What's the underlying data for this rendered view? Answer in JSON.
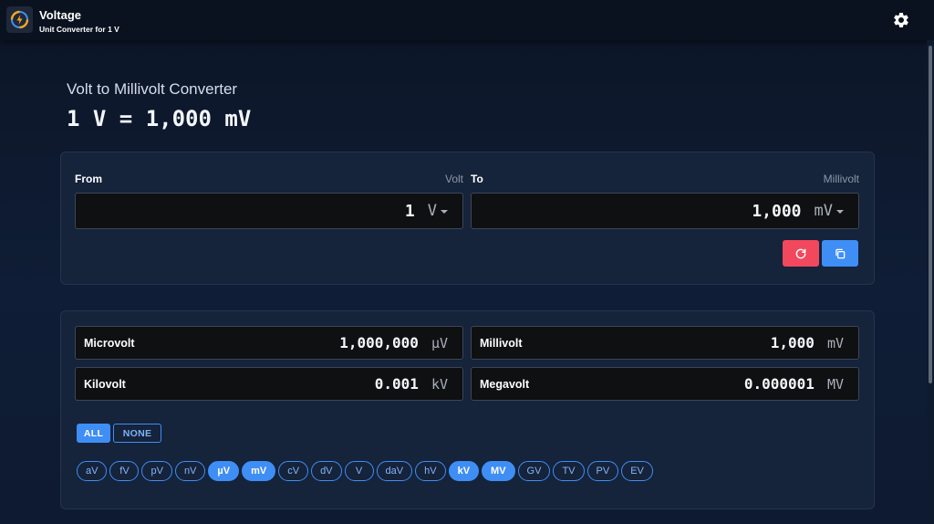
{
  "app": {
    "title": "Voltage",
    "subtitle": "Unit Converter for 1 V",
    "accent_color": "#3f8ef5",
    "reset_color": "#f2485d"
  },
  "heading": {
    "title": "Volt to Millivolt Converter",
    "result": "1 V = 1,000 mV"
  },
  "converter": {
    "from": {
      "label": "From",
      "unit_name": "Volt",
      "value": "1",
      "unit_symbol": "V"
    },
    "to": {
      "label": "To",
      "unit_name": "Millivolt",
      "value": "1,000",
      "unit_symbol": "mV"
    },
    "reset_icon": "refresh-icon",
    "copy_icon": "copy-icon"
  },
  "results": [
    {
      "name": "Microvolt",
      "value": "1,000,000",
      "unit": "µV"
    },
    {
      "name": "Millivolt",
      "value": "1,000",
      "unit": "mV"
    },
    {
      "name": "Kilovolt",
      "value": "0.001",
      "unit": "kV"
    },
    {
      "name": "Megavolt",
      "value": "0.000001",
      "unit": "MV"
    }
  ],
  "filters": {
    "all_label": "ALL",
    "none_label": "NONE"
  },
  "units": [
    {
      "label": "aV",
      "selected": false
    },
    {
      "label": "fV",
      "selected": false
    },
    {
      "label": "pV",
      "selected": false
    },
    {
      "label": "nV",
      "selected": false
    },
    {
      "label": "µV",
      "selected": true
    },
    {
      "label": "mV",
      "selected": true
    },
    {
      "label": "cV",
      "selected": false
    },
    {
      "label": "dV",
      "selected": false
    },
    {
      "label": "V",
      "selected": false
    },
    {
      "label": "daV",
      "selected": false
    },
    {
      "label": "hV",
      "selected": false
    },
    {
      "label": "kV",
      "selected": true
    },
    {
      "label": "MV",
      "selected": true
    },
    {
      "label": "GV",
      "selected": false
    },
    {
      "label": "TV",
      "selected": false
    },
    {
      "label": "PV",
      "selected": false
    },
    {
      "label": "EV",
      "selected": false
    }
  ]
}
